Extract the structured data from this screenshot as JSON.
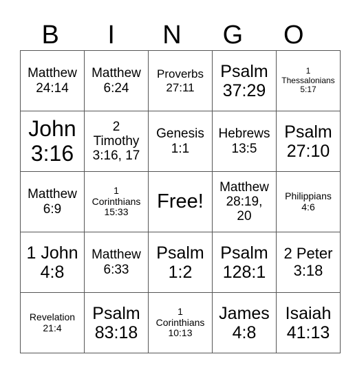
{
  "header": {
    "letters": [
      "B",
      "I",
      "N",
      "G",
      "O"
    ]
  },
  "rows": [
    [
      "Matthew\n24:14",
      "Matthew\n6:24",
      "Proverbs\n27:11",
      "Psalm\n37:29",
      "1\nThessalonians\n5:17"
    ],
    [
      "John\n3:16",
      "2\nTimothy\n3:16, 17",
      "Genesis\n1:1",
      "Hebrews\n13:5",
      "Psalm\n27:10"
    ],
    [
      "Matthew\n6:9",
      "1\nCorinthians\n15:33",
      "Free!",
      "Matthew\n28:19,\n20",
      "Philippians\n4:6"
    ],
    [
      "1 John\n4:8",
      "Matthew\n6:33",
      "Psalm\n1:2",
      "Psalm\n128:1",
      "2 Peter\n3:18"
    ],
    [
      "Revelation\n21:4",
      "Psalm\n83:18",
      "1\nCorinthians\n10:13",
      "James\n4:8",
      "Isaiah\n41:13"
    ]
  ]
}
